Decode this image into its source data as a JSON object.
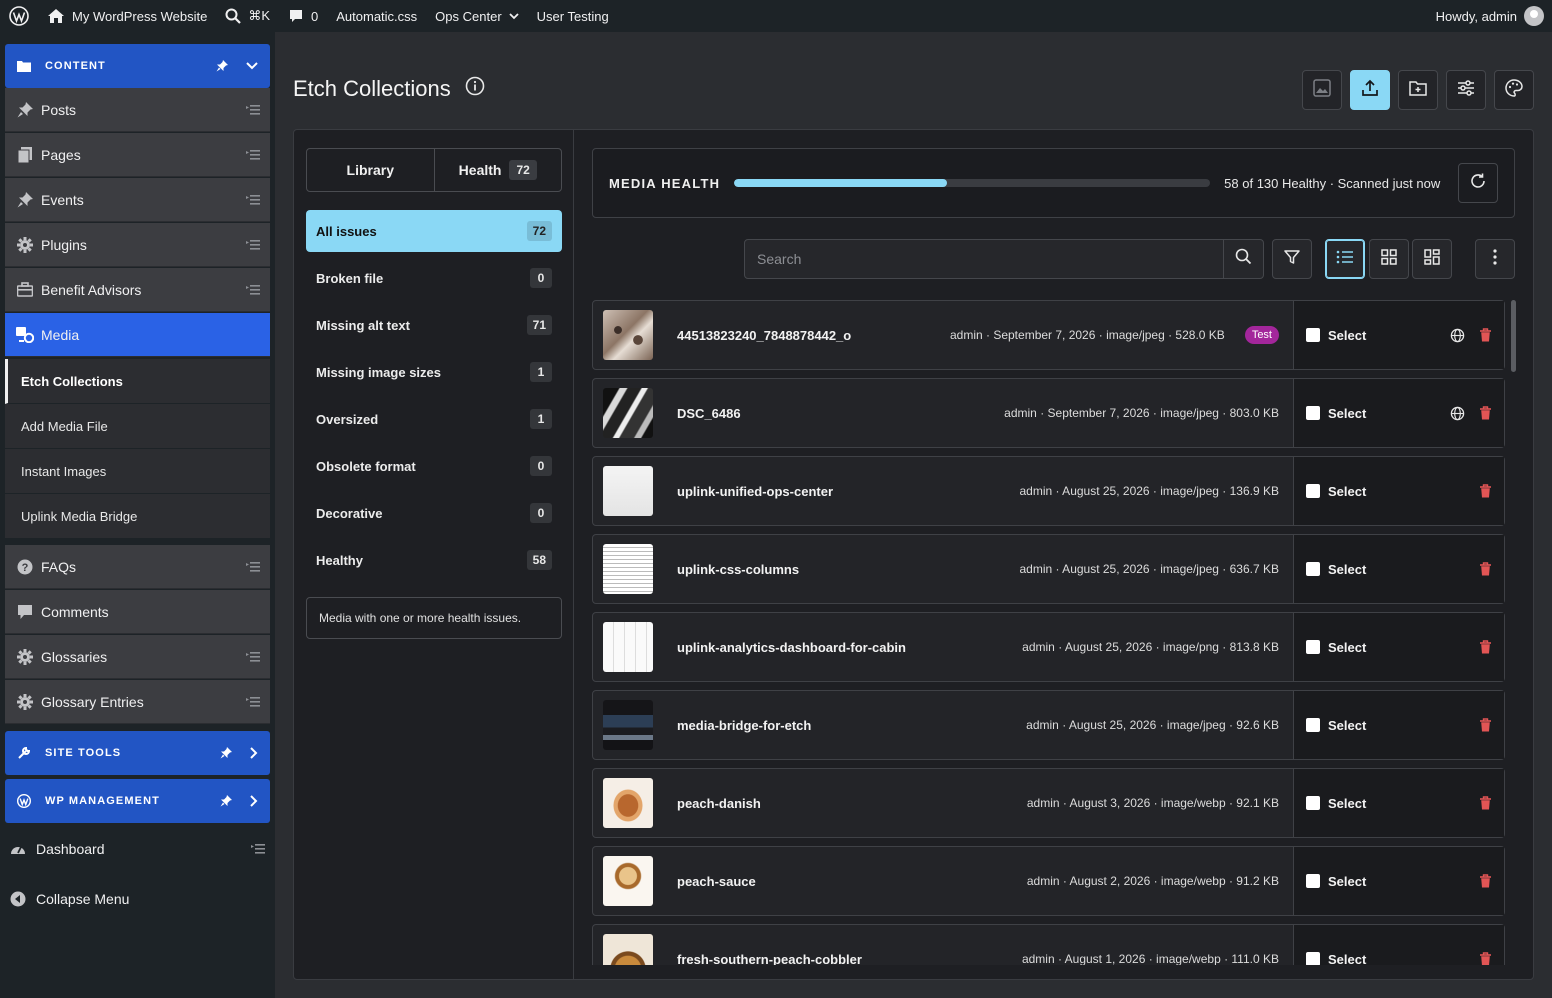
{
  "colors": {
    "accent": "#8ad8f5",
    "menu_group": "#2255c4",
    "menu_active": "#2a62e6",
    "danger": "#e25555",
    "tag": "#a3269b"
  },
  "adminbar": {
    "site_name": "My WordPress Website",
    "search_shortcut": "⌘K",
    "comments_count": "0",
    "links": [
      "Automatic.css",
      "Ops Center",
      "User Testing"
    ],
    "greeting": "Howdy, admin"
  },
  "sidebar": {
    "content_group": "CONTENT",
    "items": [
      "Posts",
      "Pages",
      "Events",
      "Plugins",
      "Benefit Advisors",
      "Media"
    ],
    "media_sub": [
      "Etch Collections",
      "Add Media File",
      "Instant Images",
      "Uplink Media Bridge"
    ],
    "items2": [
      "FAQs",
      "Comments",
      "Glossaries",
      "Glossary Entries"
    ],
    "site_tools": "SITE TOOLS",
    "wp_management": "WP MANAGEMENT",
    "dashboard": "Dashboard",
    "collapse": "Collapse Menu"
  },
  "main": {
    "title": "Etch Collections",
    "tabs": {
      "library": "Library",
      "health": "Health",
      "health_count": "72"
    },
    "filters": [
      {
        "label": "All issues",
        "count": "72"
      },
      {
        "label": "Broken file",
        "count": "0"
      },
      {
        "label": "Missing alt text",
        "count": "71"
      },
      {
        "label": "Missing image sizes",
        "count": "1"
      },
      {
        "label": "Oversized",
        "count": "1"
      },
      {
        "label": "Obsolete format",
        "count": "0"
      },
      {
        "label": "Decorative",
        "count": "0"
      },
      {
        "label": "Healthy",
        "count": "58"
      }
    ],
    "filter_description": "Media with one or more health issues.",
    "health": {
      "title": "MEDIA HEALTH",
      "status": "58 of 130 Healthy · Scanned just now",
      "healthy": 58,
      "total": 130
    },
    "search_placeholder": "Search",
    "select_label": "Select",
    "media": [
      {
        "name": "44513823240_7848878442_o",
        "meta": "admin · September 7, 2026 · image/jpeg · 528.0 KB",
        "tag": "Test",
        "globe": true
      },
      {
        "name": "DSC_6486",
        "meta": "admin · September 7, 2026 · image/jpeg · 803.0 KB",
        "tag": "",
        "globe": true
      },
      {
        "name": "uplink-unified-ops-center",
        "meta": "admin · August 25, 2026 · image/jpeg · 136.9 KB",
        "tag": "",
        "globe": false
      },
      {
        "name": "uplink-css-columns",
        "meta": "admin · August 25, 2026 · image/jpeg · 636.7 KB",
        "tag": "",
        "globe": false
      },
      {
        "name": "uplink-analytics-dashboard-for-cabin",
        "meta": "admin · August 25, 2026 · image/png · 813.8 KB",
        "tag": "",
        "globe": false
      },
      {
        "name": "media-bridge-for-etch",
        "meta": "admin · August 25, 2026 · image/jpeg · 92.6 KB",
        "tag": "",
        "globe": false
      },
      {
        "name": "peach-danish",
        "meta": "admin · August 3, 2026 · image/webp · 92.1 KB",
        "tag": "",
        "globe": false
      },
      {
        "name": "peach-sauce",
        "meta": "admin · August 2, 2026 · image/webp · 91.2 KB",
        "tag": "",
        "globe": false
      },
      {
        "name": "fresh-southern-peach-cobbler",
        "meta": "admin · August 1, 2026 · image/webp · 111.0 KB",
        "tag": "",
        "globe": false
      }
    ]
  }
}
